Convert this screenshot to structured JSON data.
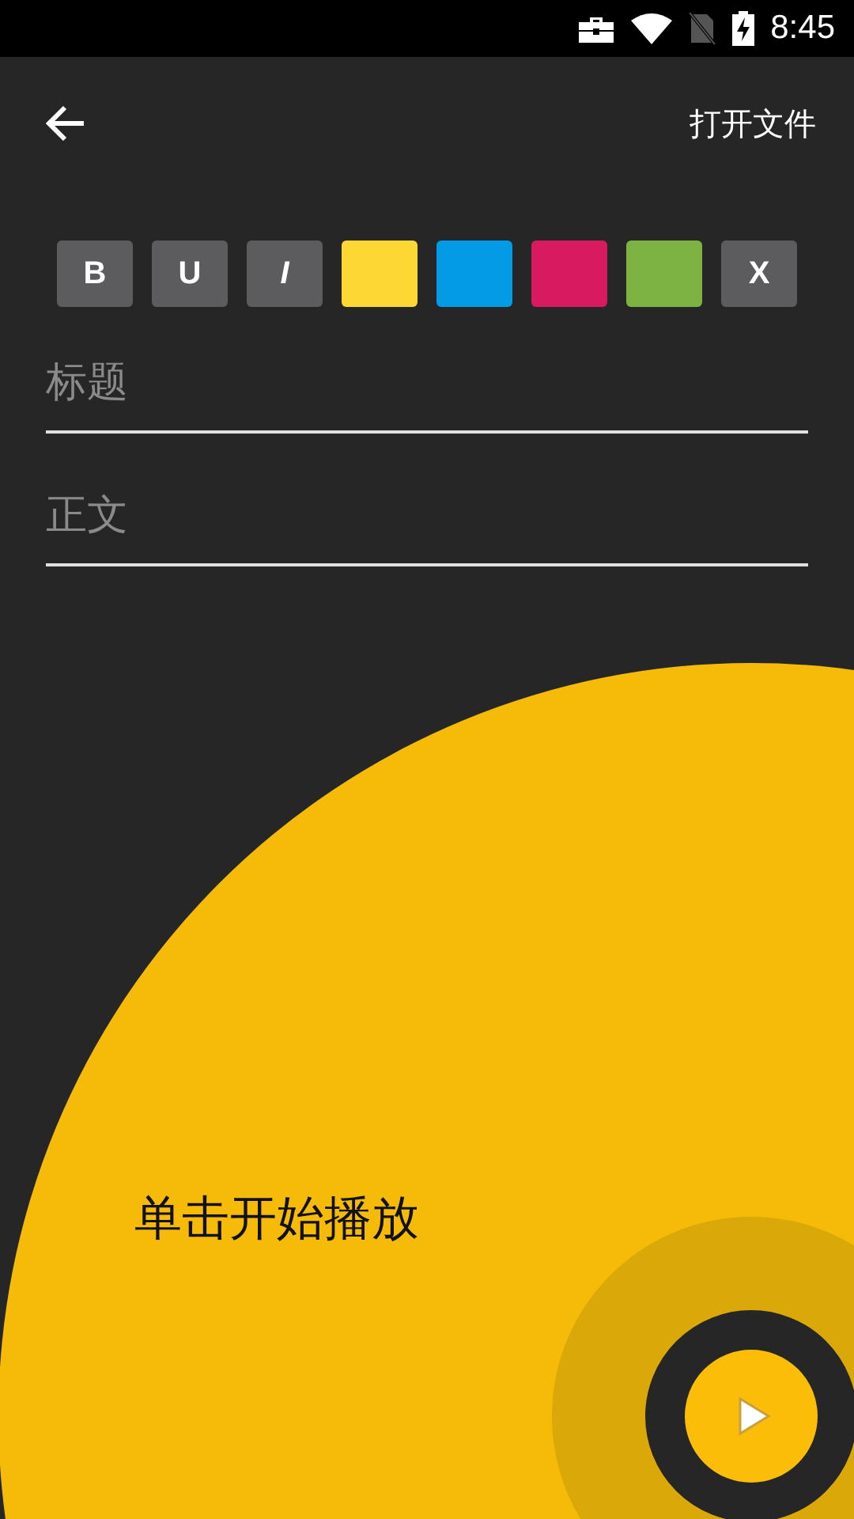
{
  "status_bar": {
    "time": "8:45"
  },
  "app_bar": {
    "action": "打开文件"
  },
  "format_buttons": [
    {
      "kind": "text",
      "label": "B"
    },
    {
      "kind": "text",
      "label": "U"
    },
    {
      "kind": "text",
      "label": "I"
    },
    {
      "kind": "color",
      "color": "#fdd835"
    },
    {
      "kind": "color",
      "color": "#039be5"
    },
    {
      "kind": "color",
      "color": "#d81b60"
    },
    {
      "kind": "color",
      "color": "#7cb342"
    },
    {
      "kind": "text",
      "label": "X"
    }
  ],
  "fields": [
    {
      "placeholder": "标题"
    },
    {
      "placeholder": "正文"
    }
  ],
  "player": {
    "hint": "单击开始播放"
  }
}
